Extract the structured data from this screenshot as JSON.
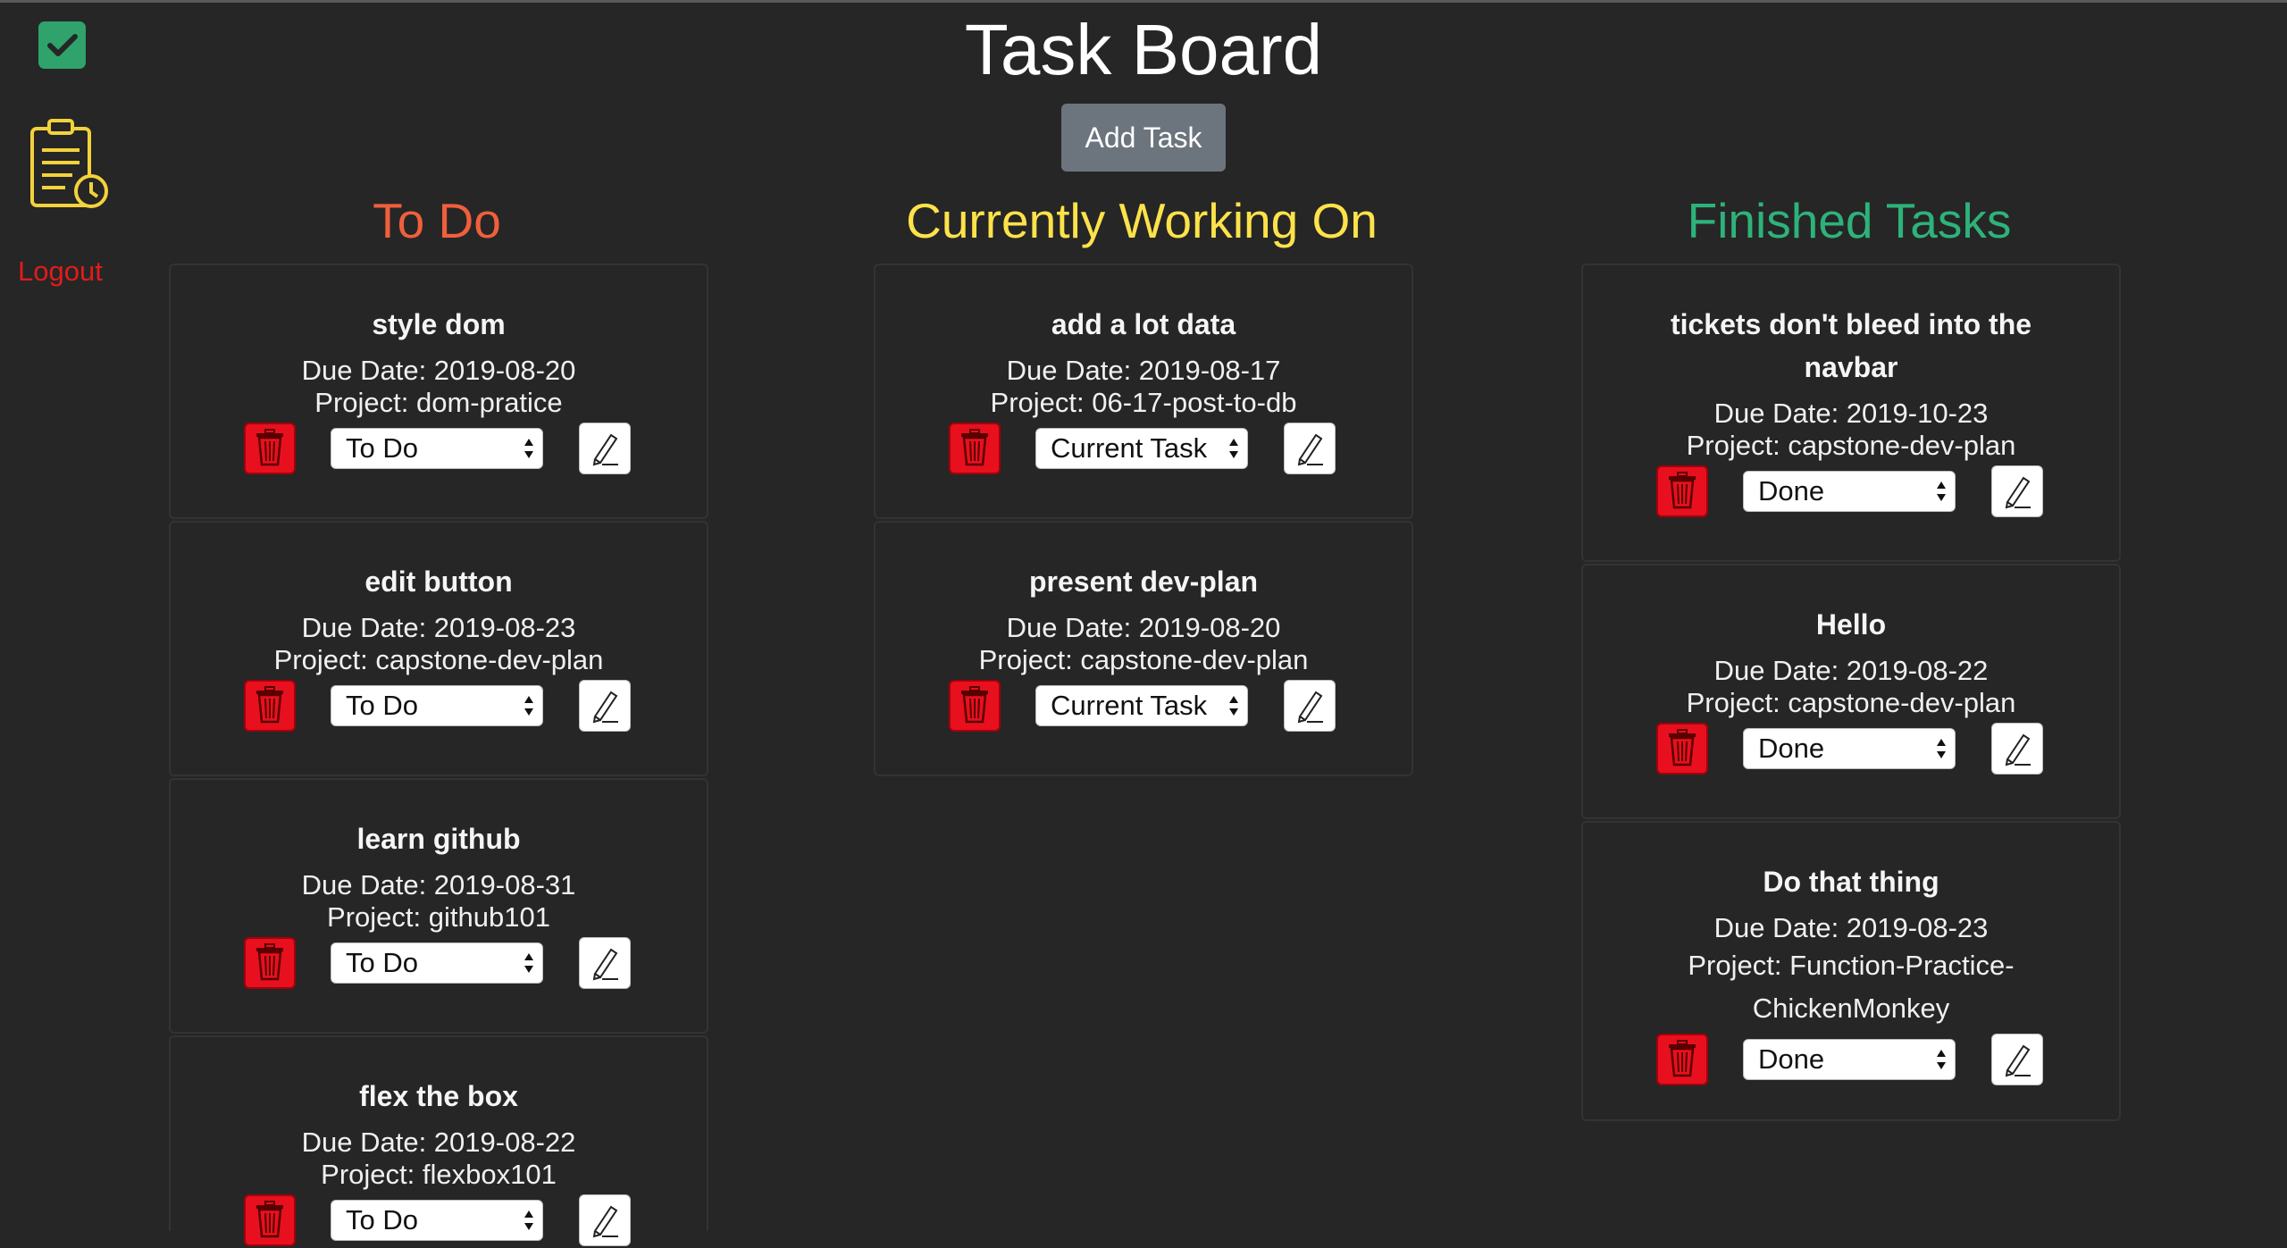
{
  "sidebar": {
    "logo_icon": "check-square-icon",
    "tasks_icon": "clipboard-clock-icon",
    "logout_label": "Logout"
  },
  "header": {
    "title": "Task Board",
    "add_task_label": "Add Task"
  },
  "columns": {
    "todo": {
      "title": "To Do",
      "color": "#f05f3c",
      "cards": [
        {
          "title": "style dom",
          "due": "Due Date: 2019-08-20",
          "project": "Project: dom-pratice",
          "status": "To Do"
        },
        {
          "title": "edit button",
          "due": "Due Date: 2019-08-23",
          "project": "Project: capstone-dev-plan",
          "status": "To Do"
        },
        {
          "title": "learn github",
          "due": "Due Date: 2019-08-31",
          "project": "Project: github101",
          "status": "To Do"
        },
        {
          "title": "flex the box",
          "due": "Due Date: 2019-08-22",
          "project": "Project: flexbox101",
          "status": "To Do"
        }
      ]
    },
    "working": {
      "title": "Currently Working On",
      "color": "#fde24a",
      "cards": [
        {
          "title": "add a lot data",
          "due": "Due Date: 2019-08-17",
          "project": "Project: 06-17-post-to-db",
          "status": "Current Task"
        },
        {
          "title": "present dev-plan",
          "due": "Due Date: 2019-08-20",
          "project": "Project: capstone-dev-plan",
          "status": "Current Task"
        }
      ]
    },
    "done": {
      "title": "Finished Tasks",
      "color": "#2db37a",
      "cards": [
        {
          "title_line1": "tickets don't bleed into the",
          "title_line2": "navbar",
          "due": "Due Date: 2019-10-23",
          "project": "Project: capstone-dev-plan",
          "status": "Done"
        },
        {
          "title": "Hello",
          "due": "Due Date: 2019-08-22",
          "project": "Project: capstone-dev-plan",
          "status": "Done"
        },
        {
          "title": "Do that thing",
          "due": "Due Date: 2019-08-23",
          "project_line1": "Project: Function-Practice-",
          "project_line2": "ChickenMonkey",
          "status": "Done"
        }
      ]
    }
  },
  "colors": {
    "background": "#262626",
    "delete_button": "#e8101e",
    "add_task_button": "#6c757d",
    "logout": "#e31b1b"
  }
}
